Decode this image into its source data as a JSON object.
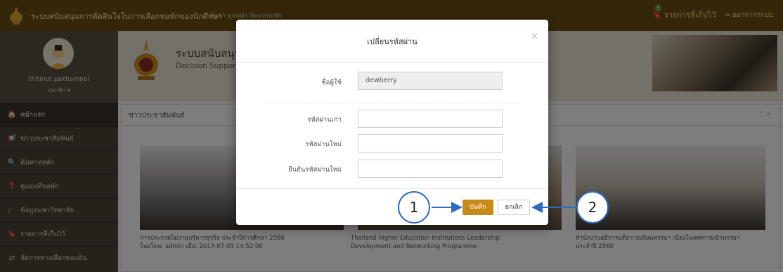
{
  "navbar": {
    "brand": "ระบบสนับสนุนการตัดสินใจในการเลือกหอพักของนักศึกษา",
    "subnav": "ค้นหา ดูหอพัก ติดต่อหอพัก",
    "saved_count": "5",
    "saved_label": "รายการที่เก็บไว้",
    "logout_label": "ออกจากระบบ"
  },
  "profile": {
    "username": "thitinut pakhamnoi",
    "role": "สมาชิก ▾"
  },
  "sidebar": {
    "items": [
      {
        "icon": "🏠",
        "label": "หน้าแรก"
      },
      {
        "icon": "📢",
        "label": "ข่าวประชาสัมพันธ์"
      },
      {
        "icon": "🔍",
        "label": "ค้นหาหอพัก"
      },
      {
        "icon": "📍",
        "label": "ดูแผนที่หอพัก"
      },
      {
        "icon": "🎓",
        "label": "ข้อมูลมหาวิทยาลัย"
      },
      {
        "icon": "🔖",
        "label": "รายการที่เก็บไว้"
      },
      {
        "icon": "⇄",
        "label": "จัดการทางเลือกของฉัน"
      }
    ]
  },
  "header": {
    "title": "ระบบสนับสนุน",
    "subtitle": "Decision Suppor"
  },
  "news": {
    "panel_title": "ข่าวประชาสัมพันธ์",
    "panel_controls": "^ ×",
    "cards": [
      {
        "title": "การประกวดไม่งามบริหารธุรกิจ ประจำปีการศึกษา 2560",
        "meta": "โพสโดย: admin เมื่อ: 2017-07-05 14:52:06"
      },
      {
        "title": "Thailand Higher Education Institutions Leadership",
        "meta": "Development and Networking Programme"
      },
      {
        "title": "สำนักงานอธิการบดีถวายเทียนพรรษา เนื่องในเทศกาลเข้าพรรษา",
        "meta": "ประจำปี 2560"
      }
    ]
  },
  "modal": {
    "title": "เปลี่ยนรหัสผ่าน",
    "close": "×",
    "username_label": "ชื่อผู้ใช้",
    "username_value": "dewberry",
    "old_password_label": "รหัสผ่านเก่า",
    "new_password_label": "รหัสผ่านใหม่",
    "confirm_password_label": "ยืนยันรหัสผ่านใหม่",
    "save_label": "บันทึก",
    "cancel_label": "ยกเลิก"
  },
  "callouts": {
    "one": "1",
    "two": "2"
  },
  "colors": {
    "navbar": "#6b4d14",
    "sidebar": "#4b4236",
    "save_button": "#c68a1b",
    "callout_stroke": "#2d6bc2"
  }
}
